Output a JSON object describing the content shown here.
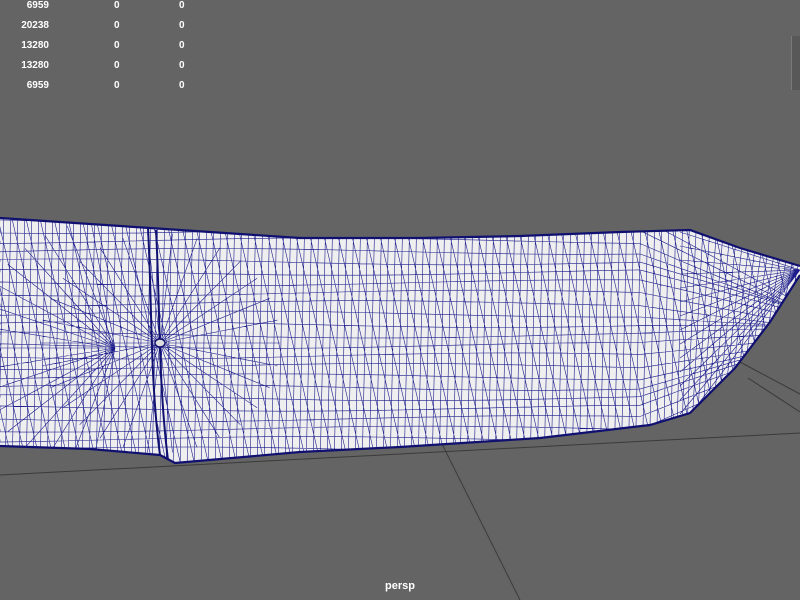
{
  "hud": {
    "rows": [
      {
        "c1": "6959",
        "c2": "0",
        "c3": "0"
      },
      {
        "c1": "20238",
        "c2": "0",
        "c3": "0"
      },
      {
        "c1": "13280",
        "c2": "0",
        "c3": "0"
      },
      {
        "c1": "13280",
        "c2": "0",
        "c3": "0"
      },
      {
        "c1": "6959",
        "c2": "0",
        "c3": "0"
      }
    ]
  },
  "viewport": {
    "camera_label": "persp",
    "background_color": "#646464",
    "wireframe_color": "#1c1c8c",
    "mesh_fill_color": "#efefef",
    "grid_color": "#3a3a3a"
  }
}
